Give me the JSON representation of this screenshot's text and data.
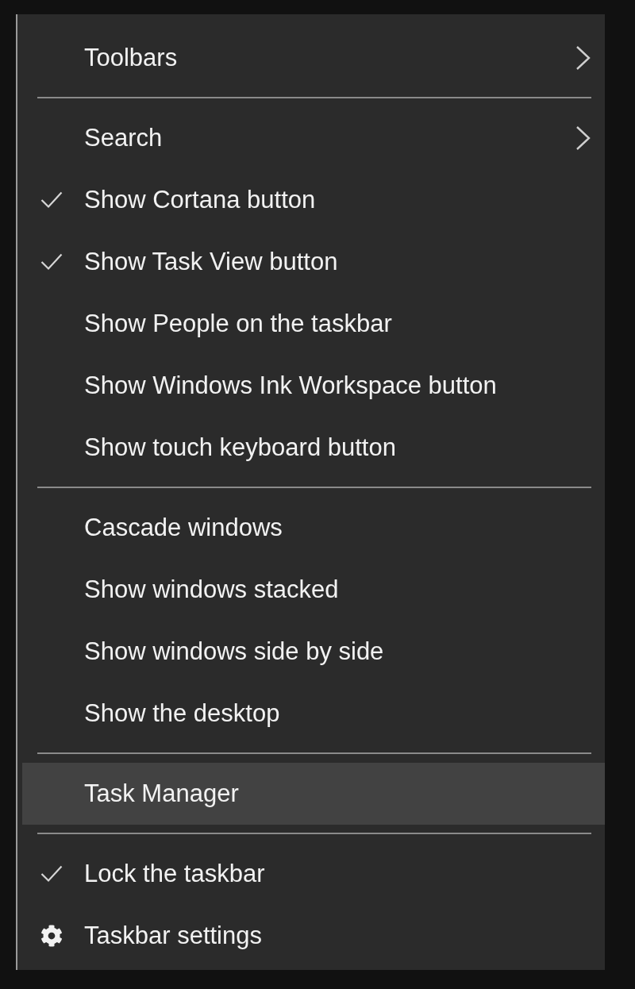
{
  "menu": {
    "items": [
      {
        "kind": "submenu",
        "label": "Toolbars",
        "selected": false
      },
      {
        "kind": "separator"
      },
      {
        "kind": "submenu",
        "label": "Search",
        "selected": false
      },
      {
        "kind": "toggle",
        "label": "Show Cortana button",
        "checked": true,
        "selected": false
      },
      {
        "kind": "toggle",
        "label": "Show Task View button",
        "checked": true,
        "selected": false
      },
      {
        "kind": "toggle",
        "label": "Show People on the taskbar",
        "checked": false,
        "selected": false
      },
      {
        "kind": "toggle",
        "label": "Show Windows Ink Workspace button",
        "checked": false,
        "selected": false
      },
      {
        "kind": "toggle",
        "label": "Show touch keyboard button",
        "checked": false,
        "selected": false
      },
      {
        "kind": "separator"
      },
      {
        "kind": "command",
        "label": "Cascade windows",
        "selected": false
      },
      {
        "kind": "command",
        "label": "Show windows stacked",
        "selected": false
      },
      {
        "kind": "command",
        "label": "Show windows side by side",
        "selected": false
      },
      {
        "kind": "command",
        "label": "Show the desktop",
        "selected": false
      },
      {
        "kind": "separator"
      },
      {
        "kind": "command",
        "label": "Task Manager",
        "selected": true
      },
      {
        "kind": "separator"
      },
      {
        "kind": "toggle",
        "label": "Lock the taskbar",
        "checked": true,
        "selected": false
      },
      {
        "kind": "settings",
        "label": "Taskbar settings",
        "selected": false
      }
    ]
  }
}
